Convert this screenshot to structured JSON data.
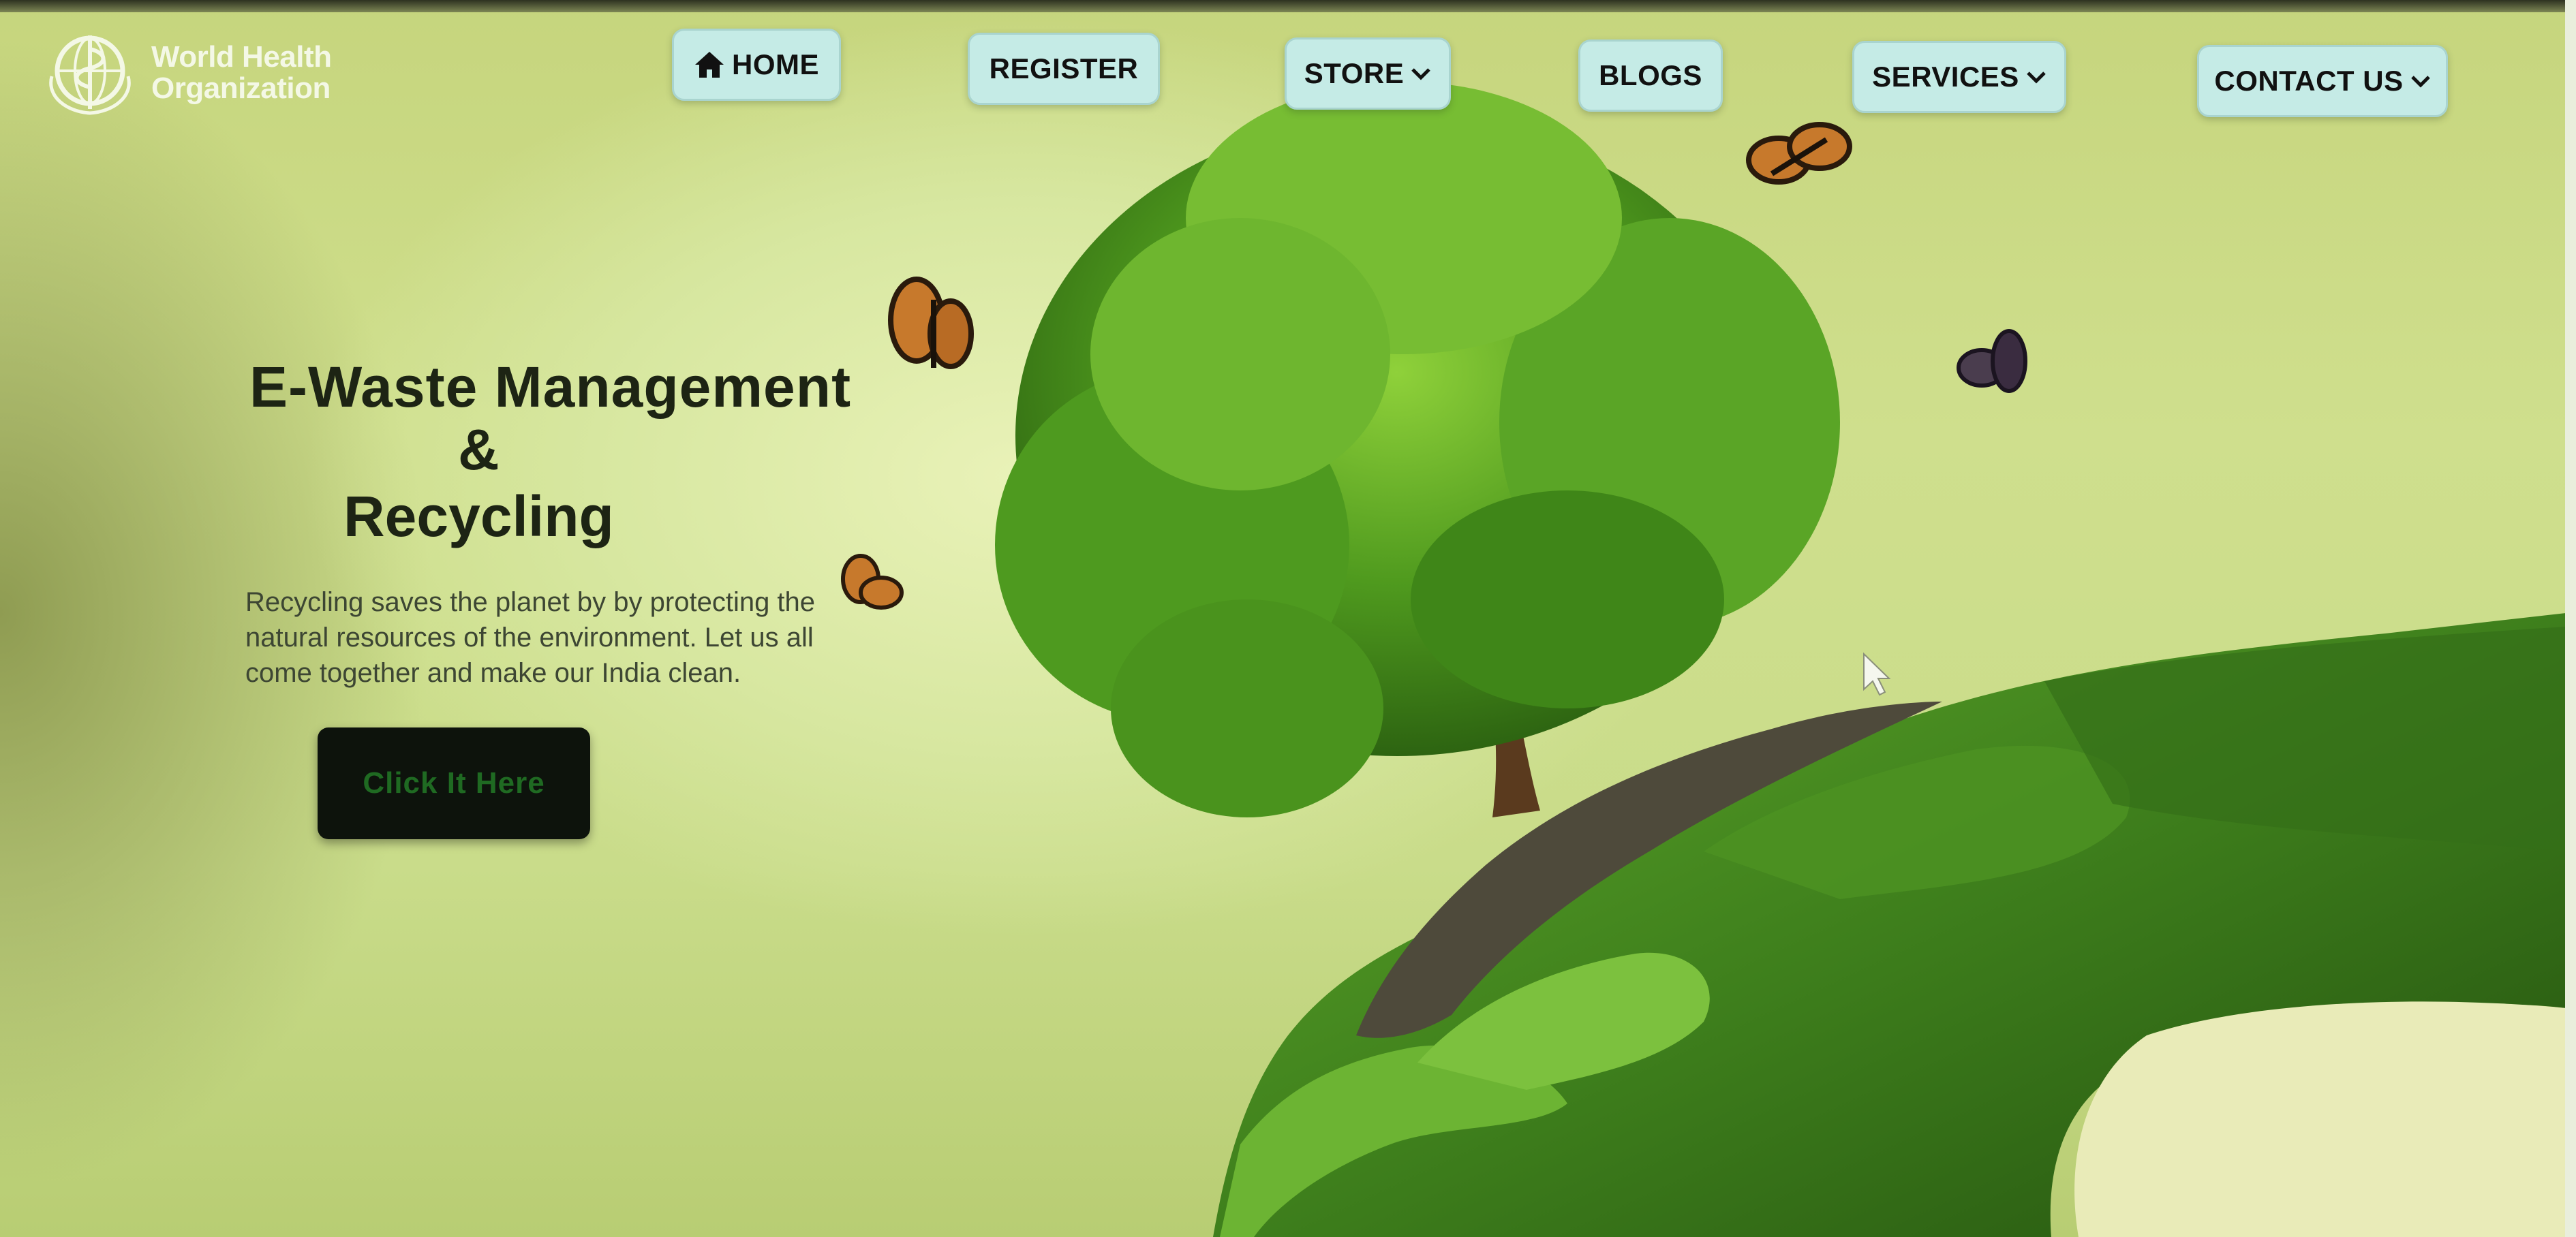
{
  "logo": {
    "line1": "World Health",
    "line2": "Organization",
    "icon": "who-emblem-icon"
  },
  "nav": {
    "home": {
      "label": "HOME",
      "icon": "home-icon"
    },
    "register": {
      "label": "REGISTER"
    },
    "store": {
      "label": "STORE",
      "icon": "chevron-down-icon"
    },
    "blogs": {
      "label": "BLOGS"
    },
    "services": {
      "label": "SERVICES",
      "icon": "chevron-down-icon"
    },
    "contact": {
      "label": "CONTACT US",
      "icon": "chevron-down-icon"
    }
  },
  "hero": {
    "title_line1": "E-Waste Management",
    "title_amp": "&",
    "title_line2": "Recycling",
    "description": "Recycling saves the planet by by protecting the natural resources of the environment. Let us all come together and make our India clean.",
    "cta_label": "Click It Here"
  },
  "colors": {
    "nav_bg": "#c5ebe6",
    "cta_bg": "#0d130c",
    "cta_text": "#1f6a22",
    "heading": "#1d2414"
  }
}
